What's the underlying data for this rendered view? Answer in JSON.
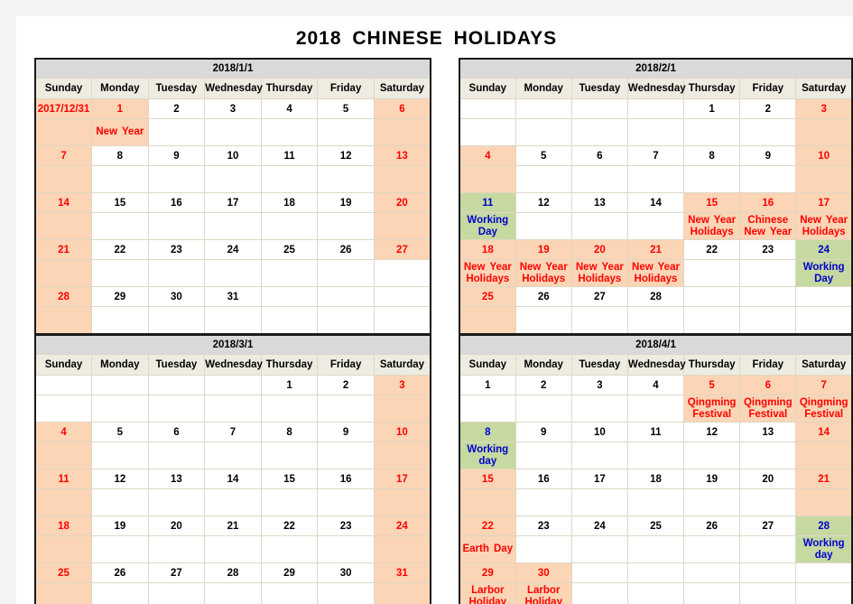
{
  "document": {
    "title": "2018  CHINESE  HOLIDAYS"
  },
  "colors": {
    "holiday_fill": "#fbd5b5",
    "workingday_fill": "#c5d9a1",
    "normal_fill": "#ffffff",
    "header_fill": "#eeece1",
    "month_title_fill": "#d9d9d9",
    "holiday_text": "#ff0000",
    "workingday_text": "#0000cc",
    "normal_text": "#000000"
  },
  "weekdays": [
    "Sunday",
    "Monday",
    "Tuesday",
    "Wednesday",
    "Thursday",
    "Friday",
    "Saturday"
  ],
  "months": [
    {
      "key": "jan",
      "title": "2018/1/1",
      "weeks": [
        [
          {
            "day": "2017/12/31",
            "note": "",
            "fill": "holiday",
            "text": "red"
          },
          {
            "day": "1",
            "note": "New  Year",
            "fill": "holiday",
            "text": "red"
          },
          {
            "day": "2",
            "note": "",
            "fill": "normal",
            "text": "black"
          },
          {
            "day": "3",
            "note": "",
            "fill": "normal",
            "text": "black"
          },
          {
            "day": "4",
            "note": "",
            "fill": "normal",
            "text": "black"
          },
          {
            "day": "5",
            "note": "",
            "fill": "normal",
            "text": "black"
          },
          {
            "day": "6",
            "note": "",
            "fill": "holiday",
            "text": "red"
          }
        ],
        [
          {
            "day": "7",
            "note": "",
            "fill": "holiday",
            "text": "red"
          },
          {
            "day": "8",
            "note": "",
            "fill": "normal",
            "text": "black"
          },
          {
            "day": "9",
            "note": "",
            "fill": "normal",
            "text": "black"
          },
          {
            "day": "10",
            "note": "",
            "fill": "normal",
            "text": "black"
          },
          {
            "day": "11",
            "note": "",
            "fill": "normal",
            "text": "black"
          },
          {
            "day": "12",
            "note": "",
            "fill": "normal",
            "text": "black"
          },
          {
            "day": "13",
            "note": "",
            "fill": "holiday",
            "text": "red"
          }
        ],
        [
          {
            "day": "14",
            "note": "",
            "fill": "holiday",
            "text": "red"
          },
          {
            "day": "15",
            "note": "",
            "fill": "normal",
            "text": "black"
          },
          {
            "day": "16",
            "note": "",
            "fill": "normal",
            "text": "black"
          },
          {
            "day": "17",
            "note": "",
            "fill": "normal",
            "text": "black"
          },
          {
            "day": "18",
            "note": "",
            "fill": "normal",
            "text": "black"
          },
          {
            "day": "19",
            "note": "",
            "fill": "normal",
            "text": "black"
          },
          {
            "day": "20",
            "note": "",
            "fill": "holiday",
            "text": "red"
          }
        ],
        [
          {
            "day": "21",
            "note": "",
            "fill": "holiday",
            "text": "red"
          },
          {
            "day": "22",
            "note": "",
            "fill": "normal",
            "text": "black"
          },
          {
            "day": "23",
            "note": "",
            "fill": "normal",
            "text": "black"
          },
          {
            "day": "24",
            "note": "",
            "fill": "normal",
            "text": "black"
          },
          {
            "day": "25",
            "note": "",
            "fill": "normal",
            "text": "black"
          },
          {
            "day": "26",
            "note": "",
            "fill": "normal",
            "text": "black"
          },
          {
            "day": "27",
            "note": "",
            "fill": "holiday",
            "text": "red",
            "note_fill": "normal"
          }
        ],
        [
          {
            "day": "28",
            "note": "",
            "fill": "holiday",
            "text": "red"
          },
          {
            "day": "29",
            "note": "",
            "fill": "normal",
            "text": "black"
          },
          {
            "day": "30",
            "note": "",
            "fill": "normal",
            "text": "black"
          },
          {
            "day": "31",
            "note": "",
            "fill": "normal",
            "text": "black"
          },
          {
            "day": "",
            "note": "",
            "fill": "normal",
            "text": "black"
          },
          {
            "day": "",
            "note": "",
            "fill": "normal",
            "text": "black"
          },
          {
            "day": "",
            "note": "",
            "fill": "normal",
            "text": "black"
          }
        ]
      ]
    },
    {
      "key": "feb",
      "title": "2018/2/1",
      "weeks": [
        [
          {
            "day": "",
            "note": "",
            "fill": "normal",
            "text": "black"
          },
          {
            "day": "",
            "note": "",
            "fill": "normal",
            "text": "black"
          },
          {
            "day": "",
            "note": "",
            "fill": "normal",
            "text": "black"
          },
          {
            "day": "",
            "note": "",
            "fill": "normal",
            "text": "black"
          },
          {
            "day": "1",
            "note": "",
            "fill": "normal",
            "text": "black"
          },
          {
            "day": "2",
            "note": "",
            "fill": "normal",
            "text": "black"
          },
          {
            "day": "3",
            "note": "",
            "fill": "holiday",
            "text": "red"
          }
        ],
        [
          {
            "day": "4",
            "note": "",
            "fill": "holiday",
            "text": "red"
          },
          {
            "day": "5",
            "note": "",
            "fill": "normal",
            "text": "black"
          },
          {
            "day": "6",
            "note": "",
            "fill": "normal",
            "text": "black"
          },
          {
            "day": "7",
            "note": "",
            "fill": "normal",
            "text": "black"
          },
          {
            "day": "8",
            "note": "",
            "fill": "normal",
            "text": "black"
          },
          {
            "day": "9",
            "note": "",
            "fill": "normal",
            "text": "black"
          },
          {
            "day": "10",
            "note": "",
            "fill": "holiday",
            "text": "red"
          }
        ],
        [
          {
            "day": "11",
            "note": "Working Day",
            "fill": "working",
            "text": "blue"
          },
          {
            "day": "12",
            "note": "",
            "fill": "normal",
            "text": "black"
          },
          {
            "day": "13",
            "note": "",
            "fill": "normal",
            "text": "black"
          },
          {
            "day": "14",
            "note": "",
            "fill": "normal",
            "text": "black"
          },
          {
            "day": "15",
            "note": "New  Year Holidays",
            "fill": "holiday",
            "text": "red"
          },
          {
            "day": "16",
            "note": "Chinese New  Year",
            "fill": "holiday",
            "text": "red"
          },
          {
            "day": "17",
            "note": "New  Year Holidays",
            "fill": "holiday",
            "text": "red"
          }
        ],
        [
          {
            "day": "18",
            "note": "New  Year Holidays",
            "fill": "holiday",
            "text": "red"
          },
          {
            "day": "19",
            "note": "New  Year Holidays",
            "fill": "holiday",
            "text": "red"
          },
          {
            "day": "20",
            "note": "New  Year Holidays",
            "fill": "holiday",
            "text": "red"
          },
          {
            "day": "21",
            "note": "New  Year Holidays",
            "fill": "holiday",
            "text": "red"
          },
          {
            "day": "22",
            "note": "",
            "fill": "normal",
            "text": "black"
          },
          {
            "day": "23",
            "note": "",
            "fill": "normal",
            "text": "black"
          },
          {
            "day": "24",
            "note": "Working Day",
            "fill": "working",
            "text": "blue"
          }
        ],
        [
          {
            "day": "25",
            "note": "",
            "fill": "holiday",
            "text": "red"
          },
          {
            "day": "26",
            "note": "",
            "fill": "normal",
            "text": "black"
          },
          {
            "day": "27",
            "note": "",
            "fill": "normal",
            "text": "black"
          },
          {
            "day": "28",
            "note": "",
            "fill": "normal",
            "text": "black"
          },
          {
            "day": "",
            "note": "",
            "fill": "normal",
            "text": "black"
          },
          {
            "day": "",
            "note": "",
            "fill": "normal",
            "text": "black"
          },
          {
            "day": "",
            "note": "",
            "fill": "normal",
            "text": "black"
          }
        ]
      ]
    },
    {
      "key": "mar",
      "title": "2018/3/1",
      "weeks": [
        [
          {
            "day": "",
            "note": "",
            "fill": "normal",
            "text": "black"
          },
          {
            "day": "",
            "note": "",
            "fill": "normal",
            "text": "black"
          },
          {
            "day": "",
            "note": "",
            "fill": "normal",
            "text": "black"
          },
          {
            "day": "",
            "note": "",
            "fill": "normal",
            "text": "black"
          },
          {
            "day": "1",
            "note": "",
            "fill": "normal",
            "text": "black"
          },
          {
            "day": "2",
            "note": "",
            "fill": "normal",
            "text": "black"
          },
          {
            "day": "3",
            "note": "",
            "fill": "holiday",
            "text": "red"
          }
        ],
        [
          {
            "day": "4",
            "note": "",
            "fill": "holiday",
            "text": "red"
          },
          {
            "day": "5",
            "note": "",
            "fill": "normal",
            "text": "black"
          },
          {
            "day": "6",
            "note": "",
            "fill": "normal",
            "text": "black"
          },
          {
            "day": "7",
            "note": "",
            "fill": "normal",
            "text": "black"
          },
          {
            "day": "8",
            "note": "",
            "fill": "normal",
            "text": "black"
          },
          {
            "day": "9",
            "note": "",
            "fill": "normal",
            "text": "black"
          },
          {
            "day": "10",
            "note": "",
            "fill": "holiday",
            "text": "red"
          }
        ],
        [
          {
            "day": "11",
            "note": "",
            "fill": "holiday",
            "text": "red"
          },
          {
            "day": "12",
            "note": "",
            "fill": "normal",
            "text": "black"
          },
          {
            "day": "13",
            "note": "",
            "fill": "normal",
            "text": "black"
          },
          {
            "day": "14",
            "note": "",
            "fill": "normal",
            "text": "black"
          },
          {
            "day": "15",
            "note": "",
            "fill": "normal",
            "text": "black"
          },
          {
            "day": "16",
            "note": "",
            "fill": "normal",
            "text": "black"
          },
          {
            "day": "17",
            "note": "",
            "fill": "holiday",
            "text": "red"
          }
        ],
        [
          {
            "day": "18",
            "note": "",
            "fill": "holiday",
            "text": "red"
          },
          {
            "day": "19",
            "note": "",
            "fill": "normal",
            "text": "black"
          },
          {
            "day": "20",
            "note": "",
            "fill": "normal",
            "text": "black"
          },
          {
            "day": "21",
            "note": "",
            "fill": "normal",
            "text": "black"
          },
          {
            "day": "22",
            "note": "",
            "fill": "normal",
            "text": "black"
          },
          {
            "day": "23",
            "note": "",
            "fill": "normal",
            "text": "black"
          },
          {
            "day": "24",
            "note": "",
            "fill": "holiday",
            "text": "red"
          }
        ],
        [
          {
            "day": "25",
            "note": "",
            "fill": "holiday",
            "text": "red"
          },
          {
            "day": "26",
            "note": "",
            "fill": "normal",
            "text": "black"
          },
          {
            "day": "27",
            "note": "",
            "fill": "normal",
            "text": "black"
          },
          {
            "day": "28",
            "note": "",
            "fill": "normal",
            "text": "black"
          },
          {
            "day": "29",
            "note": "",
            "fill": "normal",
            "text": "black"
          },
          {
            "day": "30",
            "note": "",
            "fill": "normal",
            "text": "black"
          },
          {
            "day": "31",
            "note": "",
            "fill": "holiday",
            "text": "red"
          }
        ]
      ]
    },
    {
      "key": "apr",
      "title": "2018/4/1",
      "weeks": [
        [
          {
            "day": "1",
            "note": "",
            "fill": "normal",
            "text": "black"
          },
          {
            "day": "2",
            "note": "",
            "fill": "normal",
            "text": "black"
          },
          {
            "day": "3",
            "note": "",
            "fill": "normal",
            "text": "black"
          },
          {
            "day": "4",
            "note": "",
            "fill": "normal",
            "text": "black"
          },
          {
            "day": "5",
            "note": "Qingming Festival",
            "fill": "holiday",
            "text": "red"
          },
          {
            "day": "6",
            "note": "Qingming Festival",
            "fill": "holiday",
            "text": "red"
          },
          {
            "day": "7",
            "note": "Qingming Festival",
            "fill": "holiday",
            "text": "red"
          }
        ],
        [
          {
            "day": "8",
            "note": "Working day",
            "fill": "working",
            "text": "blue"
          },
          {
            "day": "9",
            "note": "",
            "fill": "normal",
            "text": "black"
          },
          {
            "day": "10",
            "note": "",
            "fill": "normal",
            "text": "black"
          },
          {
            "day": "11",
            "note": "",
            "fill": "normal",
            "text": "black"
          },
          {
            "day": "12",
            "note": "",
            "fill": "normal",
            "text": "black"
          },
          {
            "day": "13",
            "note": "",
            "fill": "normal",
            "text": "black"
          },
          {
            "day": "14",
            "note": "",
            "fill": "holiday",
            "text": "red"
          }
        ],
        [
          {
            "day": "15",
            "note": "",
            "fill": "holiday",
            "text": "red"
          },
          {
            "day": "16",
            "note": "",
            "fill": "normal",
            "text": "black"
          },
          {
            "day": "17",
            "note": "",
            "fill": "normal",
            "text": "black"
          },
          {
            "day": "18",
            "note": "",
            "fill": "normal",
            "text": "black"
          },
          {
            "day": "19",
            "note": "",
            "fill": "normal",
            "text": "black"
          },
          {
            "day": "20",
            "note": "",
            "fill": "normal",
            "text": "black"
          },
          {
            "day": "21",
            "note": "",
            "fill": "holiday",
            "text": "red"
          }
        ],
        [
          {
            "day": "22",
            "note": "Earth  Day",
            "fill": "holiday",
            "text": "red"
          },
          {
            "day": "23",
            "note": "",
            "fill": "normal",
            "text": "black"
          },
          {
            "day": "24",
            "note": "",
            "fill": "normal",
            "text": "black"
          },
          {
            "day": "25",
            "note": "",
            "fill": "normal",
            "text": "black"
          },
          {
            "day": "26",
            "note": "",
            "fill": "normal",
            "text": "black"
          },
          {
            "day": "27",
            "note": "",
            "fill": "normal",
            "text": "black"
          },
          {
            "day": "28",
            "note": "Working day",
            "fill": "working",
            "text": "blue"
          }
        ],
        [
          {
            "day": "29",
            "note": "Larbor Holiday",
            "fill": "holiday",
            "text": "red"
          },
          {
            "day": "30",
            "note": "Larbor Holiday",
            "fill": "holiday",
            "text": "red"
          },
          {
            "day": "",
            "note": "",
            "fill": "normal",
            "text": "black"
          },
          {
            "day": "",
            "note": "",
            "fill": "normal",
            "text": "black"
          },
          {
            "day": "",
            "note": "",
            "fill": "normal",
            "text": "black"
          },
          {
            "day": "",
            "note": "",
            "fill": "normal",
            "text": "black"
          },
          {
            "day": "",
            "note": "",
            "fill": "normal",
            "text": "black"
          }
        ]
      ]
    }
  ]
}
